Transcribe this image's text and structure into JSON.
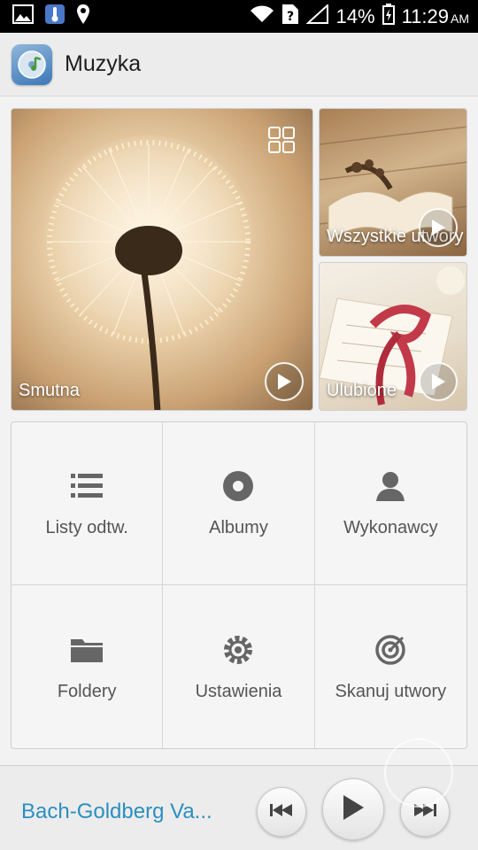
{
  "status_bar": {
    "battery": "14%",
    "time": "11:29",
    "ampm": "AM",
    "icons": [
      "gallery-icon",
      "thermometer-icon",
      "location-icon",
      "wifi-icon",
      "no-sim-icon",
      "signal-icon",
      "battery-icon"
    ]
  },
  "action_bar": {
    "title": "Muzyka",
    "icon": "music-app-icon"
  },
  "tiles": [
    {
      "label": "Smutna",
      "icon": "play-icon"
    },
    {
      "label": "Wszystkie utwory",
      "icon": "play-icon"
    },
    {
      "label": "Ulubione",
      "icon": "play-icon"
    }
  ],
  "menu": [
    {
      "label": "Listy odtw.",
      "icon": "playlist-icon"
    },
    {
      "label": "Albumy",
      "icon": "album-icon"
    },
    {
      "label": "Wykonawcy",
      "icon": "artist-icon"
    },
    {
      "label": "Foldery",
      "icon": "folder-icon"
    },
    {
      "label": "Ustawienia",
      "icon": "settings-icon"
    },
    {
      "label": "Skanuj utwory",
      "icon": "scan-icon"
    }
  ],
  "player": {
    "now_playing": "Bach-Goldberg Va...",
    "accent_color": "#2a8fc0"
  }
}
